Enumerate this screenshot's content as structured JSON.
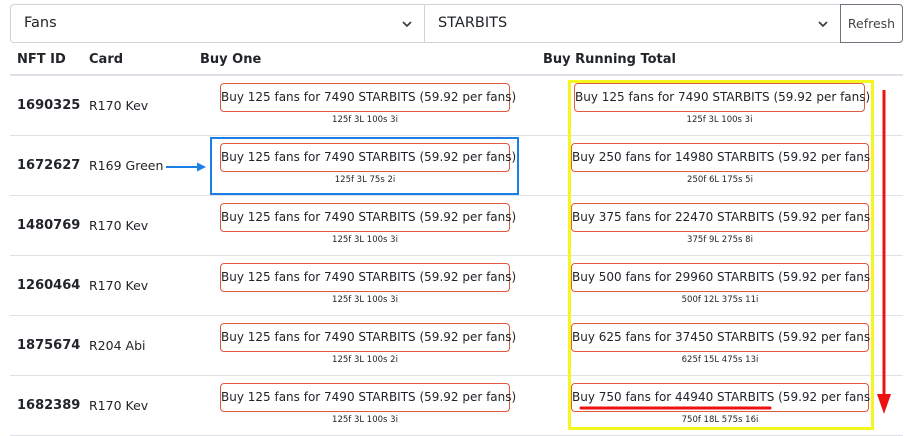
{
  "controls": {
    "type_select": "Fans",
    "currency_select": "STARBITS",
    "refresh_label": "Refresh"
  },
  "table": {
    "headers": [
      "NFT ID",
      "Card",
      "Buy One",
      "Buy Running Total"
    ],
    "rows": [
      {
        "nft_id": "1690325",
        "card": "R170 Kev",
        "buy_one": "Buy 125 fans for 7490 STARBITS (59.92 per fans)",
        "buy_one_detail": "125f 3L 100s 3i",
        "running": "Buy 125 fans for 7490 STARBITS (59.92 per fans)",
        "running_detail": "125f 3L 100s 3i"
      },
      {
        "nft_id": "1672627",
        "card": "R169 Green",
        "buy_one": "Buy 125 fans for 7490 STARBITS (59.92 per fans)",
        "buy_one_detail": "125f 3L 75s 2i",
        "running": "Buy 250 fans for 14980 STARBITS (59.92 per fans)",
        "running_detail": "250f 6L 175s 5i"
      },
      {
        "nft_id": "1480769",
        "card": "R170 Kev",
        "buy_one": "Buy 125 fans for 7490 STARBITS (59.92 per fans)",
        "buy_one_detail": "125f 3L 100s 3i",
        "running": "Buy 375 fans for 22470 STARBITS (59.92 per fans)",
        "running_detail": "375f 9L 275s 8i"
      },
      {
        "nft_id": "1260464",
        "card": "R170 Kev",
        "buy_one": "Buy 125 fans for 7490 STARBITS (59.92 per fans)",
        "buy_one_detail": "125f 3L 100s 3i",
        "running": "Buy 500 fans for 29960 STARBITS (59.92 per fans)",
        "running_detail": "500f 12L 375s 11i"
      },
      {
        "nft_id": "1875674",
        "card": "R204 Abi",
        "buy_one": "Buy 125 fans for 7490 STARBITS (59.92 per fans)",
        "buy_one_detail": "125f 3L 100s 2i",
        "running": "Buy 625 fans for 37450 STARBITS (59.92 per fans)",
        "running_detail": "625f 15L 475s 13i"
      },
      {
        "nft_id": "1682389",
        "card": "R170 Kev",
        "buy_one": "Buy 125 fans for 7490 STARBITS (59.92 per fans)",
        "buy_one_detail": "125f 3L 100s 3i",
        "running": "Buy 750 fans for 44940 STARBITS (59.92 per fans)",
        "running_detail": "750f 18L 575s 16i"
      }
    ]
  },
  "annotations": {
    "blue_arrow_icon": "arrow-right-icon",
    "red_arrow_icon": "arrow-down-icon",
    "colors": {
      "blue": "#1b7fe6",
      "yellow": "#f5f520",
      "red": "#ee1111",
      "button_border": "#e05a3c"
    }
  }
}
